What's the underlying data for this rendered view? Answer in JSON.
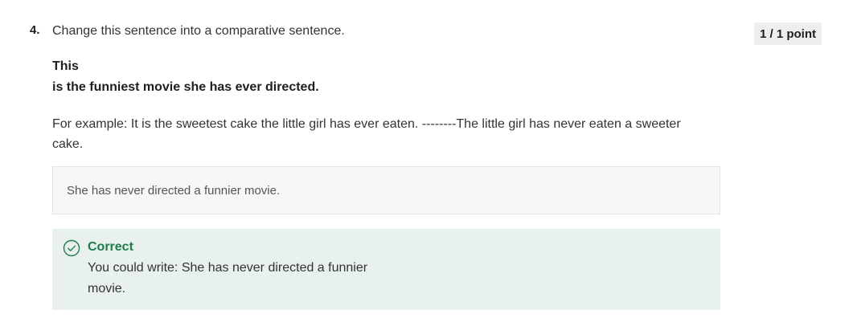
{
  "question": {
    "number": "4.",
    "prompt": "Change this sentence into a comparative sentence.",
    "score": "1 / 1 point",
    "sentence_line1": "This",
    "sentence_line2": "is the funniest movie she has ever directed.",
    "example": "For example: It is the sweetest cake the little girl has ever eaten. --------The little girl has never eaten a sweeter cake."
  },
  "answer": {
    "value": "She has never directed a funnier movie."
  },
  "feedback": {
    "status": "Correct",
    "text": "You could write: She has never directed a funnier movie.",
    "icon": "check-circle-icon",
    "accent_color": "#1e7d4a",
    "background_color": "#e8f1ee"
  }
}
